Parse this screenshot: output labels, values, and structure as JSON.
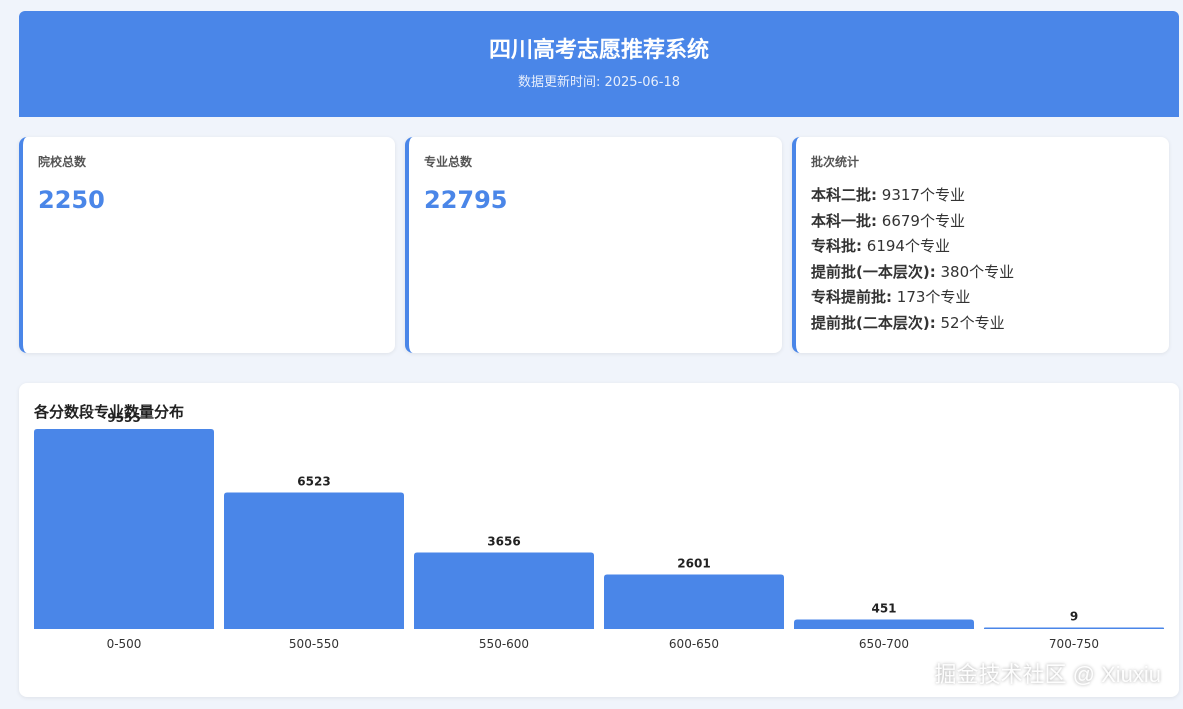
{
  "header": {
    "title": "四川高考志愿推荐系统",
    "update_label": "数据更新时间: 2025-06-18"
  },
  "stats": {
    "schools": {
      "label": "院校总数",
      "value": "2250"
    },
    "majors": {
      "label": "专业总数",
      "value": "22795"
    },
    "batches": {
      "label": "批次统计",
      "items": [
        {
          "name": "本科二批:",
          "count": "9317个专业"
        },
        {
          "name": "本科一批:",
          "count": "6679个专业"
        },
        {
          "name": "专科批:",
          "count": "6194个专业"
        },
        {
          "name": "提前批(一本层次):",
          "count": "380个专业"
        },
        {
          "name": "专科提前批:",
          "count": "173个专业"
        },
        {
          "name": "提前批(二本层次):",
          "count": "52个专业"
        }
      ]
    }
  },
  "chart": {
    "title": "各分数段专业数量分布"
  },
  "chart_data": {
    "type": "bar",
    "title": "各分数段专业数量分布",
    "categories": [
      "0-500",
      "500-550",
      "550-600",
      "600-650",
      "650-700",
      "700-750"
    ],
    "values": [
      9555,
      6523,
      3656,
      2601,
      451,
      9
    ],
    "color": "#4a86e8"
  },
  "watermark": "掘金技术社区 @ Xiuxiu",
  "colors": {
    "accent": "#4a86e8",
    "background": "#f0f4fb"
  }
}
